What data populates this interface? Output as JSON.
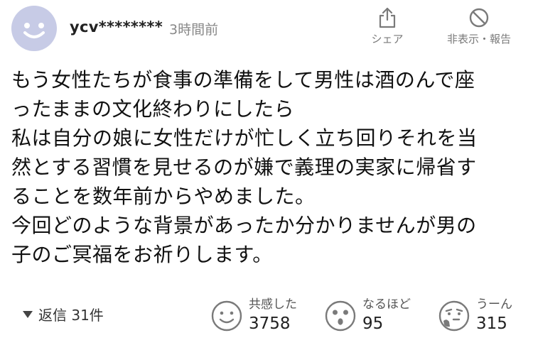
{
  "comment": {
    "username": "ycv********",
    "time": "3時間前",
    "actions": {
      "share_label": "シェア",
      "hide_report_label": "非表示・報告"
    },
    "body_lines": [
      "もう女性たちが食事の準備をして男性は酒のんで座",
      "ったままの文化終わりにしたら",
      "私は自分の娘に女性だけが忙しく立ち回りそれを当",
      "然とする習慣を見せるのが嫌で義理の実家に帰省す",
      "ることを数年前からやめました。",
      "今回どのような背景があったか分かりませんが男の",
      "子のご冥福をお祈りします。"
    ],
    "replies_label": "返信 31件",
    "reactions": [
      {
        "label": "共感した",
        "count": "3758",
        "icon": "smile-face-icon"
      },
      {
        "label": "なるほど",
        "count": "95",
        "icon": "surprised-face-icon"
      },
      {
        "label": "うーん",
        "count": "315",
        "icon": "thinking-face-icon"
      }
    ]
  },
  "colors": {
    "avatar_bg": "#c7cbe6",
    "avatar_face": "#ffffff",
    "muted": "#888888",
    "icon_gray": "#7a7a7a"
  }
}
